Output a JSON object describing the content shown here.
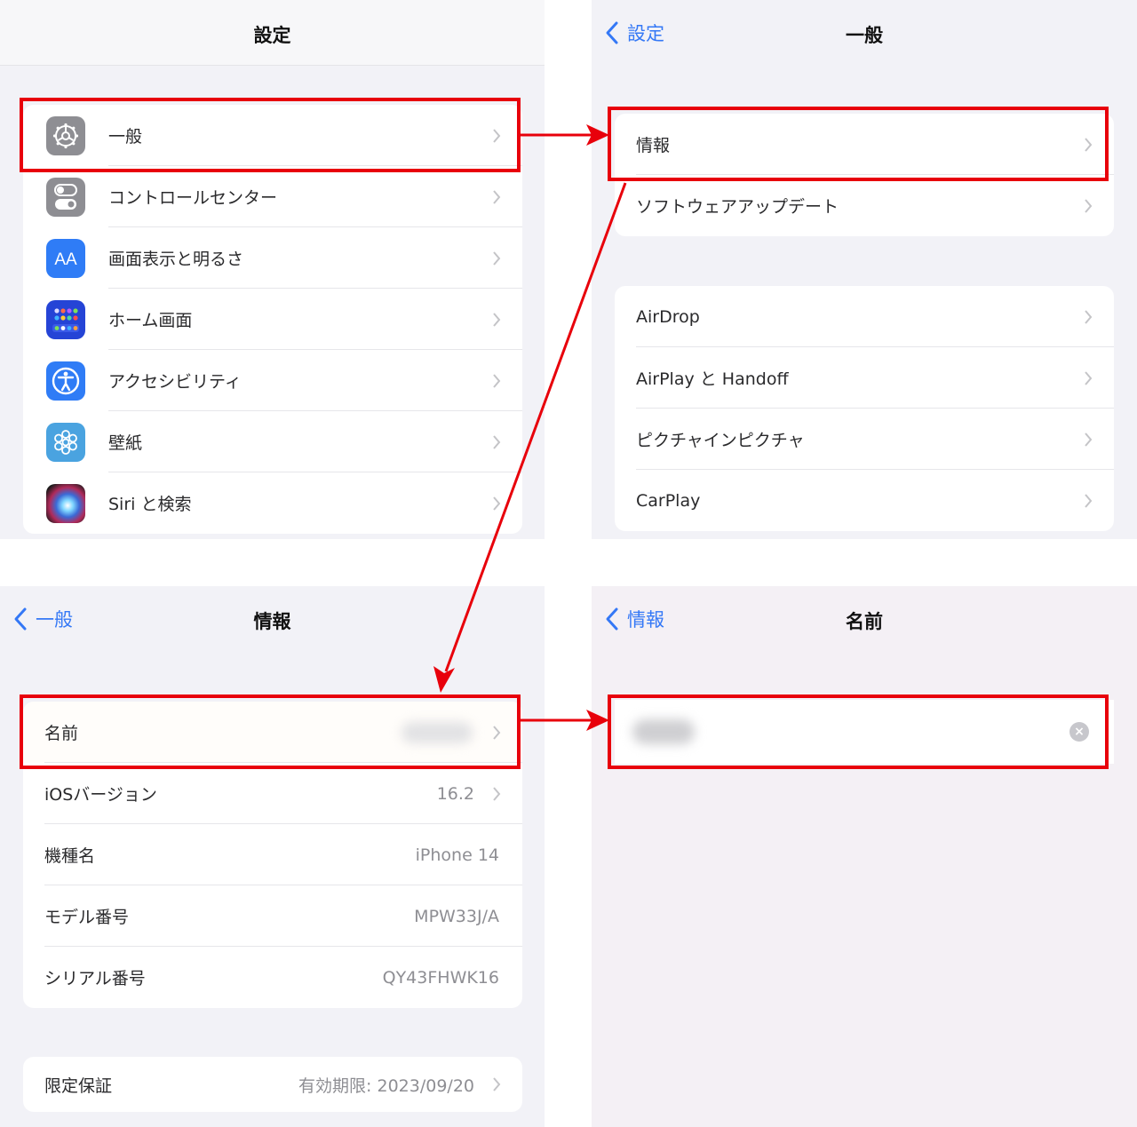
{
  "colors": {
    "accent_blue": "#3478f6",
    "highlight_red": "#e8000b",
    "background": "#f2f2f7",
    "group_bg": "#ffffff",
    "secondary_text": "#8e8e93"
  },
  "settings_screen": {
    "title": "設定",
    "items": [
      {
        "label": "一般",
        "icon": "gear-icon",
        "highlighted": true
      },
      {
        "label": "コントロールセンター",
        "icon": "control-center-icon"
      },
      {
        "label": "画面表示と明るさ",
        "icon": "display-brightness-icon"
      },
      {
        "label": "ホーム画面",
        "icon": "home-screen-icon"
      },
      {
        "label": "アクセシビリティ",
        "icon": "accessibility-icon"
      },
      {
        "label": "壁紙",
        "icon": "wallpaper-icon"
      },
      {
        "label": "Siri と検索",
        "icon": "siri-icon"
      }
    ]
  },
  "general_screen": {
    "back_label": "設定",
    "title": "一般",
    "group1": [
      {
        "label": "情報",
        "highlighted": true
      },
      {
        "label": "ソフトウェアアップデート"
      }
    ],
    "group2": [
      {
        "label": "AirDrop"
      },
      {
        "label": "AirPlay と Handoff"
      },
      {
        "label": "ピクチャインピクチャ"
      },
      {
        "label": "CarPlay"
      }
    ]
  },
  "about_screen": {
    "back_label": "一般",
    "title": "情報",
    "group1": [
      {
        "label": "名前",
        "value": "",
        "value_blurred": true,
        "highlighted": true
      },
      {
        "label": "iOSバージョン",
        "value": "16.2"
      },
      {
        "label": "機種名",
        "value": "iPhone 14"
      },
      {
        "label": "モデル番号",
        "value": "MPW33J/A"
      },
      {
        "label": "シリアル番号",
        "value": "QY43FHWK16"
      }
    ],
    "group2": [
      {
        "label": "限定保証",
        "value": "有効期限: 2023/09/20"
      }
    ]
  },
  "name_screen": {
    "back_label": "情報",
    "title": "名前",
    "field_value_blurred": true,
    "clear_icon": "clear-icon",
    "clear_glyph": "×"
  }
}
